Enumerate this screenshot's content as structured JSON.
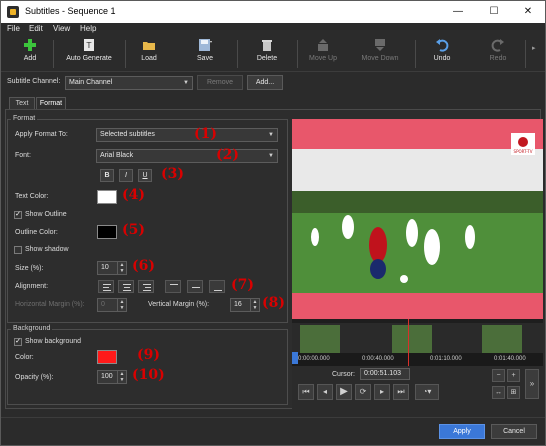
{
  "window": {
    "title": "Subtitles - Sequence 1",
    "controls": [
      "—",
      "☐",
      "✕"
    ]
  },
  "menu": [
    "File",
    "Edit",
    "View",
    "Help"
  ],
  "toolbar": {
    "add": "Add",
    "auto_generate": "Auto Generate",
    "load": "Load",
    "save": "Save",
    "delete": "Delete",
    "move_up": "Move Up",
    "move_down": "Move Down",
    "undo": "Undo",
    "redo": "Redo"
  },
  "channel": {
    "label": "Subtitle Channel:",
    "value": "Main Channel",
    "remove": "Remove",
    "add": "Add..."
  },
  "tabs": [
    "Text",
    "Format"
  ],
  "format": {
    "group_title": "Format",
    "apply_label": "Apply Format To:",
    "apply_value": "Selected subtitles",
    "font_label": "Font:",
    "font_value": "Arial Black",
    "bold": "B",
    "italic": "I",
    "underline": "U",
    "text_color_label": "Text Color:",
    "show_outline": "Show Outline",
    "outline_color_label": "Outline Color:",
    "show_shadow": "Show shadow",
    "size_label": "Size (%):",
    "size_value": "10",
    "alignment_label": "Alignment:",
    "h_margin_label": "Horizontal Margin (%):",
    "h_margin_value": "0",
    "v_margin_label": "Vertical Margin (%):",
    "v_margin_value": "16"
  },
  "background": {
    "group_title": "Background",
    "show_background": "Show background",
    "color_label": "Color:",
    "opacity_label": "Opacity (%):",
    "opacity_value": "100"
  },
  "annotations": [
    "(1)",
    "(2)",
    "(3)",
    "(4)",
    "(5)",
    "(6)",
    "(7)",
    "(8)",
    "(9)",
    "(10)"
  ],
  "colors": {
    "text_color": "#ffffff",
    "outline_color": "#000000",
    "background_color": "#ff1a1a",
    "annotation": "#d90000",
    "accent": "#3b78d8",
    "subtitle_bar": "#e8576b"
  },
  "preview": {
    "logo_text": "SPORT-TV"
  },
  "timeline": {
    "ticks": [
      "0:00:00.000",
      "0:00:40.000",
      "0:01:10.000",
      "0:01:40.000"
    ],
    "cursor_label": "Cursor:",
    "cursor_value": "0:00:51.103"
  },
  "footer": {
    "apply": "Apply",
    "cancel": "Cancel"
  }
}
